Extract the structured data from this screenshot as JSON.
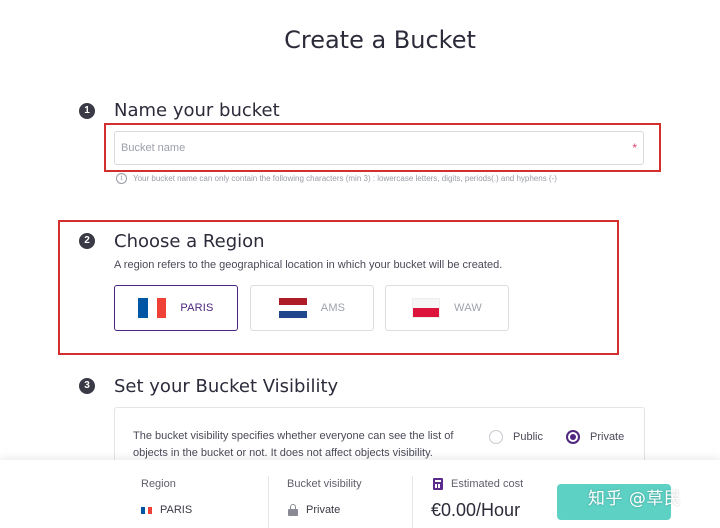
{
  "page": {
    "title": "Create a Bucket"
  },
  "steps": {
    "name": {
      "number": "1",
      "title": "Name your bucket",
      "placeholder": "Bucket name",
      "value": "",
      "required_marker": "*",
      "hint": "Your bucket name can only contain the following characters (min 3) : lowercase letters, digits, periods(.) and hyphens (-)"
    },
    "region": {
      "number": "2",
      "title": "Choose a Region",
      "description": "A region refers to the geographical location in which your bucket will be created.",
      "selected": "PARIS",
      "options": [
        {
          "label": "PARIS",
          "flag": "france-flag",
          "colors": [
            "#0055a4",
            "#ffffff",
            "#ef4135"
          ],
          "selected": true
        },
        {
          "label": "AMS",
          "flag": "netherlands-flag",
          "colors": [
            "#ae1c28",
            "#ffffff",
            "#21468b"
          ],
          "selected": false
        },
        {
          "label": "WAW",
          "flag": "poland-flag",
          "colors": [
            "#f0f0f0",
            "#dc143c"
          ],
          "selected": false
        }
      ]
    },
    "visibility": {
      "number": "3",
      "title": "Set your Bucket Visibility",
      "description": "The bucket visibility specifies whether everyone can see the list of objects in the bucket or not. It does not affect objects visibility.",
      "options": [
        {
          "label": "Public",
          "checked": false
        },
        {
          "label": "Private",
          "checked": true
        }
      ]
    }
  },
  "summary": {
    "region_label": "Region",
    "region_value": "PARIS",
    "visibility_label": "Bucket visibility",
    "visibility_value": "Private",
    "cost_label": "Estimated cost",
    "cost_value": "€0.00/Hour"
  },
  "watermark": "知乎 @草民",
  "colors": {
    "accent": "#4f2580",
    "highlight_border": "#d32f2f",
    "required": "#e0426e",
    "submit_bg": "#5cd1c4"
  }
}
